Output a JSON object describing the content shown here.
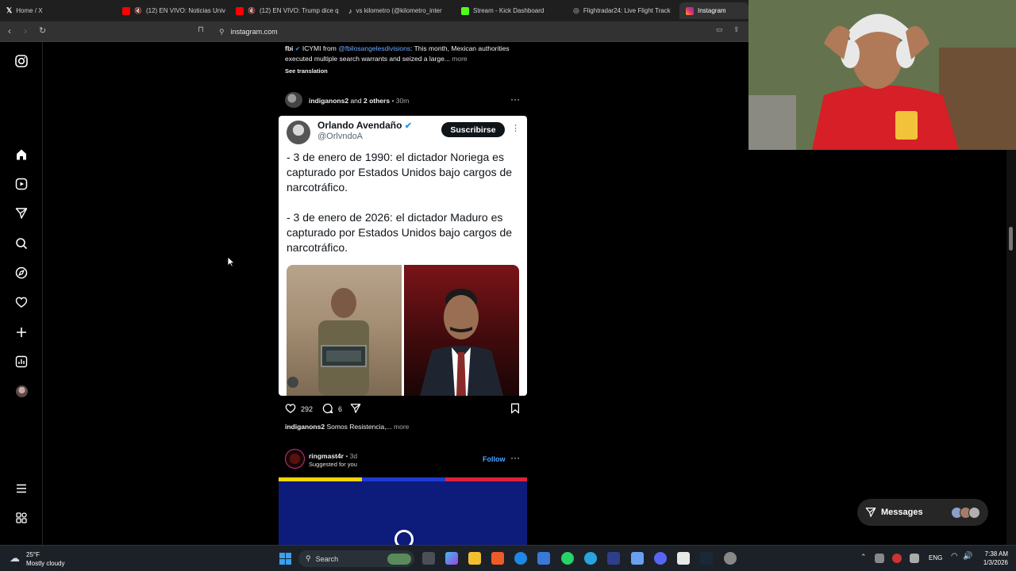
{
  "browser": {
    "tabs": [
      {
        "label": "Home / X",
        "icon": "x-logo-icon",
        "color": "#ffffff"
      },
      {
        "label": "(12) EN VIVO: Noticias Univ",
        "icon": "youtube-icon",
        "color": "#ff0000"
      },
      {
        "label": "(12) EN VIVO: Trump dice q",
        "icon": "youtube-icon",
        "color": "#ff0000"
      },
      {
        "label": "vs kilometro (@kilometro_inter",
        "icon": "tiktok-icon",
        "color": "#ffffff"
      },
      {
        "label": "Stream - Kick Dashboard",
        "icon": "kick-icon",
        "color": "#53fc18"
      },
      {
        "label": "Flightradar24: Live Flight Track",
        "icon": "radar-icon",
        "color": "#cfcfcf"
      },
      {
        "label": "Instagram",
        "icon": "instagram-icon",
        "color": "#e1306c"
      }
    ],
    "url": "instagram.com"
  },
  "post1": {
    "author": "fbi",
    "icymi": "ICYMI from",
    "mention": "@fbilosangelesdivisions",
    "caption": ": This month, Mexican authorities executed multiple search warrants and seized a large...",
    "more": "more",
    "see_translation": "See translation"
  },
  "post2": {
    "header_user": "indiganons2",
    "header_and": "and",
    "header_others": "2 others",
    "time": "30m",
    "tweet": {
      "name": "Orlando Avendaño",
      "handle": "@OrlvndoA",
      "subscribe": "Suscribirse",
      "line1": "- 3 de enero de 1990: el dictador Noriega es capturado por Estados Unidos bajo cargos de narcotráfico.",
      "line2": "- 3 de enero de 2026: el dictador Maduro es capturado por Estados Unidos bajo cargos de narcotráfico."
    },
    "likes": "292",
    "comments": "6",
    "caption_user": "indiganons2",
    "caption": "Somos Resistencia,...",
    "more": "more"
  },
  "post3": {
    "user": "ringmast4r",
    "time": "3d",
    "suggested": "Suggested for you",
    "follow": "Follow"
  },
  "messages": {
    "label": "Messages"
  },
  "taskbar": {
    "weather_temp": "25°F",
    "weather_desc": "Mostly cloudy",
    "search": "Search",
    "lang": "ENG",
    "time": "7:38 AM",
    "date": "1/3/2026"
  },
  "colors": {
    "accent_link": "#6fa8ff",
    "follow": "#0095f6",
    "verified": "#1d9bf0"
  }
}
